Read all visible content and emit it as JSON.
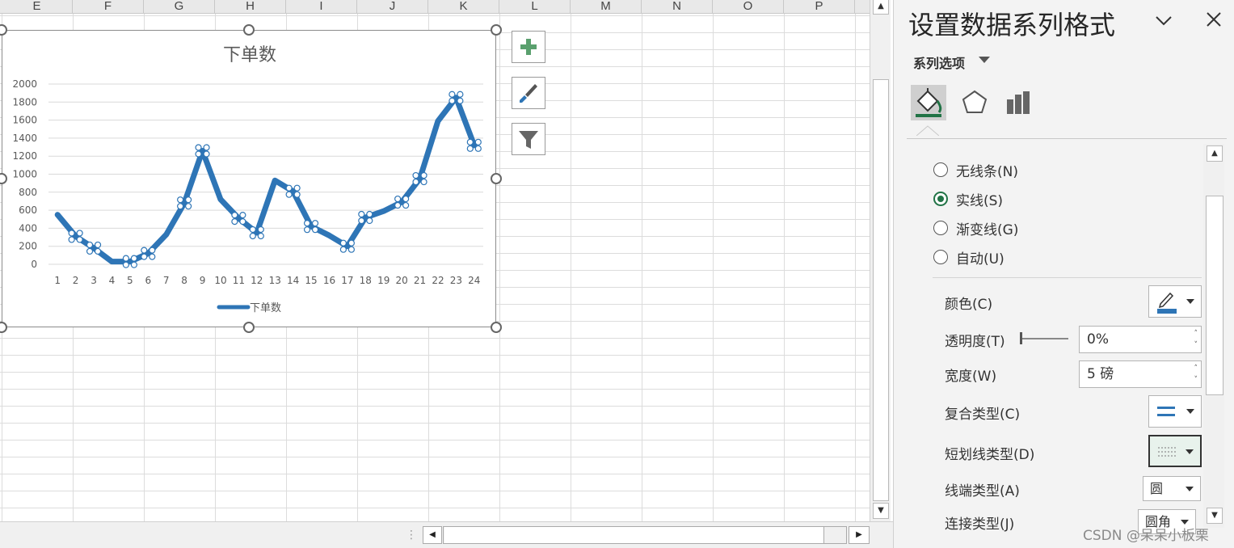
{
  "sheet": {
    "columns": [
      "E",
      "F",
      "G",
      "H",
      "I",
      "J",
      "K",
      "L",
      "M",
      "N",
      "O",
      "P"
    ]
  },
  "chart_data": {
    "type": "line",
    "title": "下单数",
    "categories": [
      "1",
      "2",
      "3",
      "4",
      "5",
      "6",
      "7",
      "8",
      "9",
      "10",
      "11",
      "12",
      "13",
      "14",
      "15",
      "16",
      "17",
      "18",
      "19",
      "20",
      "21",
      "22",
      "23",
      "24"
    ],
    "series": [
      {
        "name": "下单数",
        "values": [
          550,
          310,
          180,
          30,
          30,
          120,
          330,
          680,
          1260,
          720,
          510,
          350,
          930,
          810,
          420,
          320,
          200,
          520,
          590,
          690,
          950,
          1590,
          1850,
          1320
        ],
        "color": "#2e75b6"
      }
    ],
    "y_ticks": [
      "2000",
      "1800",
      "1600",
      "1400",
      "1200",
      "1000",
      "800",
      "600",
      "400",
      "200",
      "0"
    ],
    "ylim": [
      0,
      2000
    ],
    "grid": true,
    "legend": "bottom",
    "selected_points": [
      1,
      2,
      4,
      5,
      7,
      8,
      10,
      11,
      13,
      14,
      16,
      17,
      19,
      20,
      22,
      23
    ]
  },
  "pane": {
    "title": "设置数据系列格式",
    "series_options": "系列选项",
    "radios": [
      {
        "label": "无线条(N)",
        "checked": false
      },
      {
        "label": "实线(S)",
        "checked": true
      },
      {
        "label": "渐变线(G)",
        "checked": false
      },
      {
        "label": "自动(U)",
        "checked": false
      }
    ],
    "color_label": "颜色(C)",
    "transparency_label": "透明度(T)",
    "transparency_value": "0%",
    "width_label": "宽度(W)",
    "width_value": "5 磅",
    "compound_label": "复合类型(C)",
    "dash_label": "短划线类型(D)",
    "cap_label": "线端类型(A)",
    "cap_value": "圆",
    "join_label": "连接类型(J)",
    "join_value": "圆角"
  },
  "watermark": "CSDN @呆呆小板栗",
  "colors": {
    "accent": "#217346",
    "series": "#2e75b6"
  }
}
